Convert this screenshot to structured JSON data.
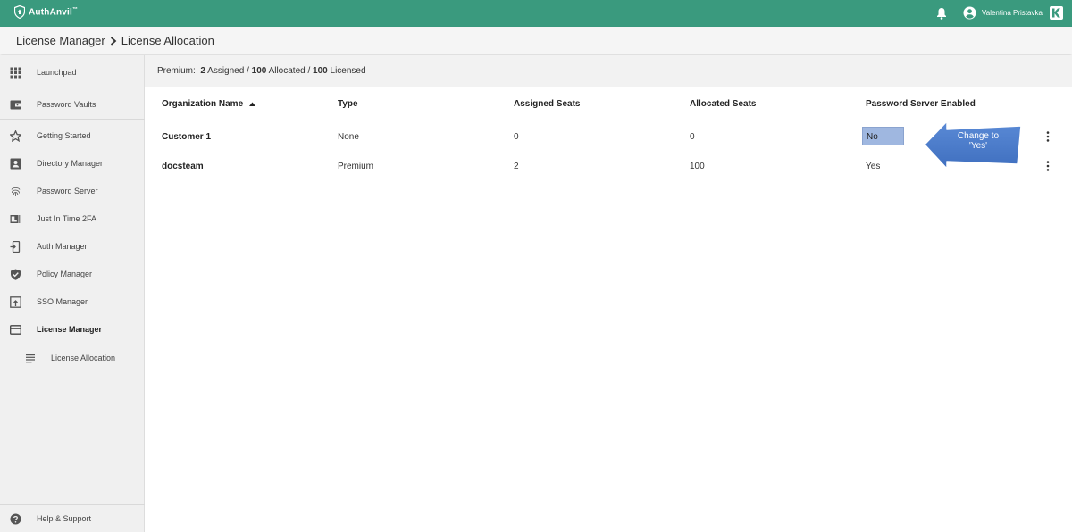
{
  "app": {
    "brand": "AuthAnvil",
    "brand_mark": "™"
  },
  "topbar": {
    "user_name": "Valentina Pristavka",
    "color": "#3a9a7e"
  },
  "breadcrumb": {
    "parent": "License Manager",
    "current": "License Allocation"
  },
  "sidebar": {
    "items": [
      {
        "label": "Launchpad",
        "icon": "grid-icon"
      },
      {
        "label": "Password Vaults",
        "icon": "wallet-icon"
      },
      {
        "label": "Getting Started",
        "icon": "star-icon"
      },
      {
        "label": "Directory Manager",
        "icon": "contact-card-icon"
      },
      {
        "label": "Password Server",
        "icon": "fingerprint-icon"
      },
      {
        "label": "Just In Time 2FA",
        "icon": "id-badge-icon"
      },
      {
        "label": "Auth Manager",
        "icon": "phone-login-icon"
      },
      {
        "label": "Policy Manager",
        "icon": "verified-shield-icon"
      },
      {
        "label": "SSO Manager",
        "icon": "window-login-icon"
      },
      {
        "label": "License Manager",
        "icon": "credit-card-icon",
        "active": true
      },
      {
        "label": "License Allocation",
        "icon": "list-lines-icon",
        "sub": true
      }
    ],
    "help": {
      "label": "Help & Support",
      "icon": "help-circle-icon"
    }
  },
  "summary": {
    "tier": "Premium:",
    "assigned_num": "2",
    "assigned_label": "Assigned",
    "sep1": "/",
    "allocated_num": "100",
    "allocated_label": "Allocated",
    "sep2": "/",
    "licensed_num": "100",
    "licensed_label": "Licensed"
  },
  "table": {
    "columns": [
      "Organization Name",
      "Type",
      "Assigned Seats",
      "Allocated Seats",
      "Password Server Enabled"
    ],
    "rows": [
      {
        "org": "Customer 1",
        "type": "None",
        "assigned": "0",
        "allocated": "0",
        "password_server": "No"
      },
      {
        "org": "docsteam",
        "type": "Premium",
        "assigned": "2",
        "allocated": "100",
        "password_server": "Yes"
      }
    ]
  },
  "callout": {
    "line1": "Change to",
    "line2": "'Yes'",
    "color": "#4a7bc8"
  }
}
